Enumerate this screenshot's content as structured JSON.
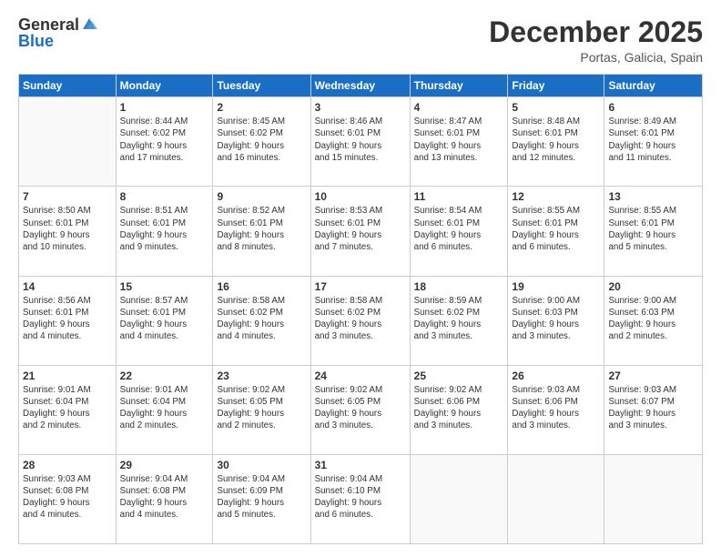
{
  "header": {
    "logo_general": "General",
    "logo_blue": "Blue",
    "month_title": "December 2025",
    "location": "Portas, Galicia, Spain"
  },
  "days_of_week": [
    "Sunday",
    "Monday",
    "Tuesday",
    "Wednesday",
    "Thursday",
    "Friday",
    "Saturday"
  ],
  "weeks": [
    [
      {
        "day": "",
        "text": ""
      },
      {
        "day": "1",
        "text": "Sunrise: 8:44 AM\nSunset: 6:02 PM\nDaylight: 9 hours\nand 17 minutes."
      },
      {
        "day": "2",
        "text": "Sunrise: 8:45 AM\nSunset: 6:02 PM\nDaylight: 9 hours\nand 16 minutes."
      },
      {
        "day": "3",
        "text": "Sunrise: 8:46 AM\nSunset: 6:01 PM\nDaylight: 9 hours\nand 15 minutes."
      },
      {
        "day": "4",
        "text": "Sunrise: 8:47 AM\nSunset: 6:01 PM\nDaylight: 9 hours\nand 13 minutes."
      },
      {
        "day": "5",
        "text": "Sunrise: 8:48 AM\nSunset: 6:01 PM\nDaylight: 9 hours\nand 12 minutes."
      },
      {
        "day": "6",
        "text": "Sunrise: 8:49 AM\nSunset: 6:01 PM\nDaylight: 9 hours\nand 11 minutes."
      }
    ],
    [
      {
        "day": "7",
        "text": "Sunrise: 8:50 AM\nSunset: 6:01 PM\nDaylight: 9 hours\nand 10 minutes."
      },
      {
        "day": "8",
        "text": "Sunrise: 8:51 AM\nSunset: 6:01 PM\nDaylight: 9 hours\nand 9 minutes."
      },
      {
        "day": "9",
        "text": "Sunrise: 8:52 AM\nSunset: 6:01 PM\nDaylight: 9 hours\nand 8 minutes."
      },
      {
        "day": "10",
        "text": "Sunrise: 8:53 AM\nSunset: 6:01 PM\nDaylight: 9 hours\nand 7 minutes."
      },
      {
        "day": "11",
        "text": "Sunrise: 8:54 AM\nSunset: 6:01 PM\nDaylight: 9 hours\nand 6 minutes."
      },
      {
        "day": "12",
        "text": "Sunrise: 8:55 AM\nSunset: 6:01 PM\nDaylight: 9 hours\nand 6 minutes."
      },
      {
        "day": "13",
        "text": "Sunrise: 8:55 AM\nSunset: 6:01 PM\nDaylight: 9 hours\nand 5 minutes."
      }
    ],
    [
      {
        "day": "14",
        "text": "Sunrise: 8:56 AM\nSunset: 6:01 PM\nDaylight: 9 hours\nand 4 minutes."
      },
      {
        "day": "15",
        "text": "Sunrise: 8:57 AM\nSunset: 6:01 PM\nDaylight: 9 hours\nand 4 minutes."
      },
      {
        "day": "16",
        "text": "Sunrise: 8:58 AM\nSunset: 6:02 PM\nDaylight: 9 hours\nand 4 minutes."
      },
      {
        "day": "17",
        "text": "Sunrise: 8:58 AM\nSunset: 6:02 PM\nDaylight: 9 hours\nand 3 minutes."
      },
      {
        "day": "18",
        "text": "Sunrise: 8:59 AM\nSunset: 6:02 PM\nDaylight: 9 hours\nand 3 minutes."
      },
      {
        "day": "19",
        "text": "Sunrise: 9:00 AM\nSunset: 6:03 PM\nDaylight: 9 hours\nand 3 minutes."
      },
      {
        "day": "20",
        "text": "Sunrise: 9:00 AM\nSunset: 6:03 PM\nDaylight: 9 hours\nand 2 minutes."
      }
    ],
    [
      {
        "day": "21",
        "text": "Sunrise: 9:01 AM\nSunset: 6:04 PM\nDaylight: 9 hours\nand 2 minutes."
      },
      {
        "day": "22",
        "text": "Sunrise: 9:01 AM\nSunset: 6:04 PM\nDaylight: 9 hours\nand 2 minutes."
      },
      {
        "day": "23",
        "text": "Sunrise: 9:02 AM\nSunset: 6:05 PM\nDaylight: 9 hours\nand 2 minutes."
      },
      {
        "day": "24",
        "text": "Sunrise: 9:02 AM\nSunset: 6:05 PM\nDaylight: 9 hours\nand 3 minutes."
      },
      {
        "day": "25",
        "text": "Sunrise: 9:02 AM\nSunset: 6:06 PM\nDaylight: 9 hours\nand 3 minutes."
      },
      {
        "day": "26",
        "text": "Sunrise: 9:03 AM\nSunset: 6:06 PM\nDaylight: 9 hours\nand 3 minutes."
      },
      {
        "day": "27",
        "text": "Sunrise: 9:03 AM\nSunset: 6:07 PM\nDaylight: 9 hours\nand 3 minutes."
      }
    ],
    [
      {
        "day": "28",
        "text": "Sunrise: 9:03 AM\nSunset: 6:08 PM\nDaylight: 9 hours\nand 4 minutes."
      },
      {
        "day": "29",
        "text": "Sunrise: 9:04 AM\nSunset: 6:08 PM\nDaylight: 9 hours\nand 4 minutes."
      },
      {
        "day": "30",
        "text": "Sunrise: 9:04 AM\nSunset: 6:09 PM\nDaylight: 9 hours\nand 5 minutes."
      },
      {
        "day": "31",
        "text": "Sunrise: 9:04 AM\nSunset: 6:10 PM\nDaylight: 9 hours\nand 6 minutes."
      },
      {
        "day": "",
        "text": ""
      },
      {
        "day": "",
        "text": ""
      },
      {
        "day": "",
        "text": ""
      }
    ]
  ]
}
